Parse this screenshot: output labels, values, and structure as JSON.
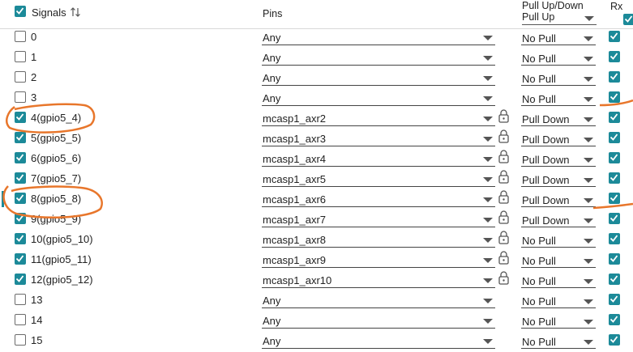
{
  "header": {
    "signals_label": "Signals",
    "pins_label": "Pins",
    "pull_title": "Pull Up/Down",
    "pull_value": "Pull Up",
    "rx_label": "Rx",
    "signals_checked": true,
    "rx_checked": true
  },
  "rows": [
    {
      "signal": "0",
      "checked": false,
      "pin": "Any",
      "locked": false,
      "pull": "No Pull",
      "rx": true
    },
    {
      "signal": "1",
      "checked": false,
      "pin": "Any",
      "locked": false,
      "pull": "No Pull",
      "rx": true
    },
    {
      "signal": "2",
      "checked": false,
      "pin": "Any",
      "locked": false,
      "pull": "No Pull",
      "rx": true
    },
    {
      "signal": "3",
      "checked": false,
      "pin": "Any",
      "locked": false,
      "pull": "No Pull",
      "rx": true
    },
    {
      "signal": "4(gpio5_4)",
      "checked": true,
      "pin": "mcasp1_axr2",
      "locked": true,
      "pull": "Pull Down",
      "rx": true
    },
    {
      "signal": "5(gpio5_5)",
      "checked": true,
      "pin": "mcasp1_axr3",
      "locked": true,
      "pull": "Pull Down",
      "rx": true
    },
    {
      "signal": "6(gpio5_6)",
      "checked": true,
      "pin": "mcasp1_axr4",
      "locked": true,
      "pull": "Pull Down",
      "rx": true
    },
    {
      "signal": "7(gpio5_7)",
      "checked": true,
      "pin": "mcasp1_axr5",
      "locked": true,
      "pull": "Pull Down",
      "rx": true
    },
    {
      "signal": "8(gpio5_8)",
      "checked": true,
      "pin": "mcasp1_axr6",
      "locked": true,
      "pull": "Pull Down",
      "rx": true
    },
    {
      "signal": "9(gpio5_9)",
      "checked": true,
      "pin": "mcasp1_axr7",
      "locked": true,
      "pull": "Pull Down",
      "rx": true
    },
    {
      "signal": "10(gpio5_10)",
      "checked": true,
      "pin": "mcasp1_axr8",
      "locked": true,
      "pull": "No Pull",
      "rx": true
    },
    {
      "signal": "11(gpio5_11)",
      "checked": true,
      "pin": "mcasp1_axr9",
      "locked": true,
      "pull": "No Pull",
      "rx": true
    },
    {
      "signal": "12(gpio5_12)",
      "checked": true,
      "pin": "mcasp1_axr10",
      "locked": true,
      "pull": "No Pull",
      "rx": true
    },
    {
      "signal": "13",
      "checked": false,
      "pin": "Any",
      "locked": false,
      "pull": "No Pull",
      "rx": true
    },
    {
      "signal": "14",
      "checked": false,
      "pin": "Any",
      "locked": false,
      "pull": "No Pull",
      "rx": true
    },
    {
      "signal": "15",
      "checked": false,
      "pin": "Any",
      "locked": false,
      "pull": "No Pull",
      "rx": true
    }
  ],
  "icons": {
    "sort": "sort-icon",
    "lock": "lock-icon",
    "dropdown": "chevron-down-icon"
  },
  "colors": {
    "checkbox_checked": "#1c8a99",
    "annotation": "#e8762b"
  }
}
